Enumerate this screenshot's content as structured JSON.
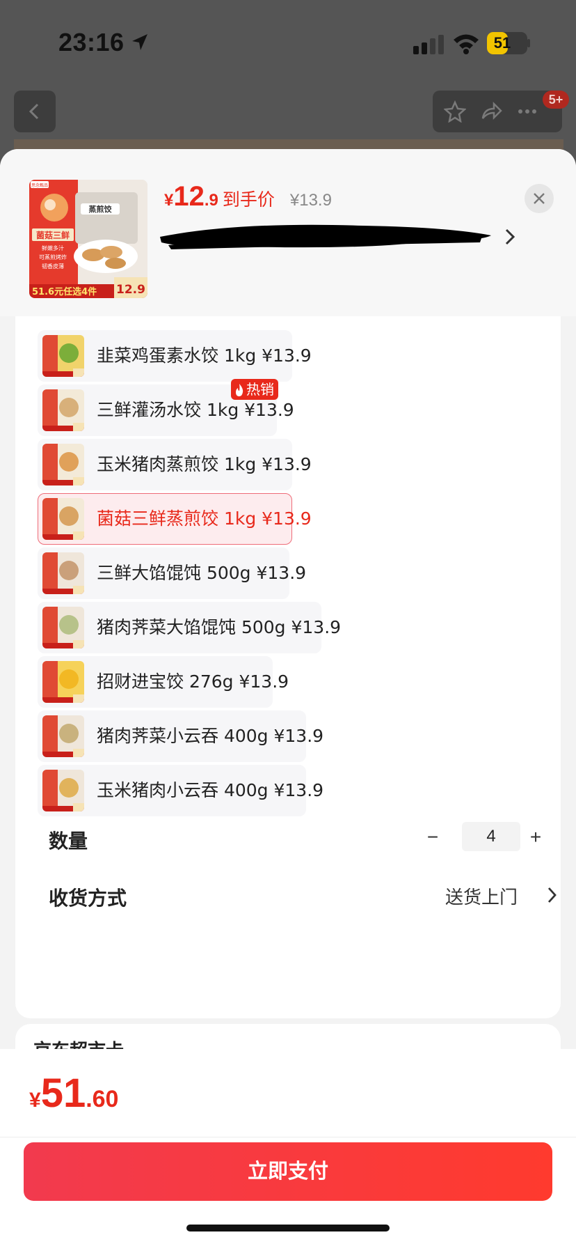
{
  "status_bar": {
    "time": "23:16",
    "battery_level": 51,
    "battery_text": "51"
  },
  "background": {
    "cart_badge": "5+"
  },
  "product": {
    "price_symbol": "¥",
    "price_int": "12",
    "price_dec": ".9",
    "price_label": "到手价",
    "original_price": "¥13.9",
    "thumb_text": {
      "brand": "思念甄品",
      "pack_name": "蒸煎饺",
      "flavor": "菌菇三鲜",
      "tag1": "鲜嫩多汁",
      "tag2": "可蒸煎烤炸",
      "tag3": "韧香皮薄",
      "promo": "51.6元任选4件",
      "promo_price": "12.9"
    }
  },
  "variants": [
    {
      "label": "韭菜鸡蛋素水饺 1kg  ¥13.9",
      "selected": false,
      "hot": false
    },
    {
      "label": "三鲜灌汤水饺 1kg  ¥13.9",
      "selected": false,
      "hot": true
    },
    {
      "label": "玉米猪肉蒸煎饺 1kg  ¥13.9",
      "selected": false,
      "hot": false
    },
    {
      "label": "菌菇三鲜蒸煎饺 1kg  ¥13.9",
      "selected": true,
      "hot": false
    },
    {
      "label": "三鲜大馅馄饨 500g  ¥13.9",
      "selected": false,
      "hot": false
    },
    {
      "label": "猪肉荠菜大馅馄饨 500g  ¥13.9",
      "selected": false,
      "hot": false
    },
    {
      "label": "招财进宝饺 276g  ¥13.9",
      "selected": false,
      "hot": false
    },
    {
      "label": "猪肉荠菜小云吞 400g  ¥13.9",
      "selected": false,
      "hot": false
    },
    {
      "label": "玉米猪肉小云吞 400g  ¥13.9",
      "selected": false,
      "hot": false
    }
  ],
  "hot_badge": "热销",
  "quantity": {
    "label": "数量",
    "value": "4",
    "minus": "−",
    "plus": "+"
  },
  "shipping": {
    "label": "收货方式",
    "value": "送货上门"
  },
  "next_section": {
    "title": "京东超市卡",
    "right": ""
  },
  "footer": {
    "total_symbol": "¥",
    "total_int": "51",
    "total_dec": ".60",
    "pay_label": "立即支付"
  },
  "colors": {
    "accent": "#e8291b",
    "selected_bg": "#fdecee",
    "selected_border": "#ee6c78"
  }
}
